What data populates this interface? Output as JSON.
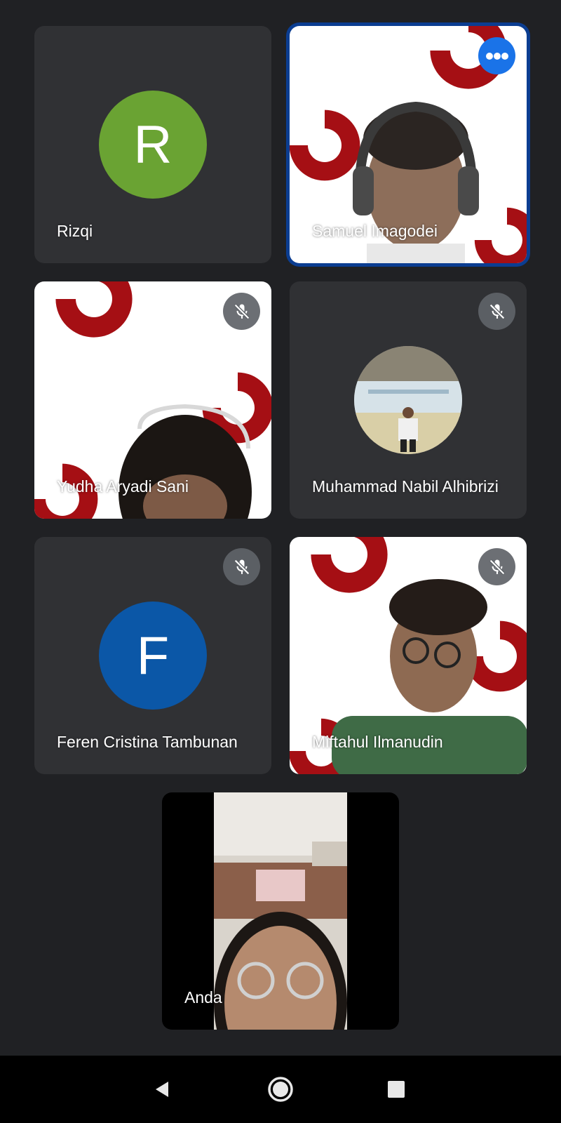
{
  "participants": [
    {
      "name": "Rizqi",
      "initial": "R",
      "avatar_color": "#6aa333",
      "type": "avatar"
    },
    {
      "name": "Samuel Imagodei",
      "type": "video",
      "speaking": true
    },
    {
      "name": "Yudha Aryadi Sani",
      "type": "video",
      "muted": true
    },
    {
      "name": "Muhammad Nabil Alhibrizi",
      "type": "photo",
      "muted": true
    },
    {
      "name": "Feren Cristina Tambunan",
      "initial": "F",
      "avatar_color": "#0b57a7",
      "type": "avatar",
      "muted": true
    },
    {
      "name": "Miftahul Ilmanudin",
      "type": "video",
      "muted": true
    },
    {
      "name": "Anda",
      "type": "video",
      "self": true
    }
  ],
  "colors": {
    "background": "#202124",
    "tile": "#303134",
    "accent": "#1a73e8",
    "active_border": "#0b3d91",
    "logo_red": "#a50f14"
  },
  "icons": {
    "muted": "mic-off-icon",
    "speaking": "audio-dots-icon",
    "nav_back": "back-triangle-icon",
    "nav_home": "home-circle-icon",
    "nav_recents": "recents-square-icon"
  }
}
